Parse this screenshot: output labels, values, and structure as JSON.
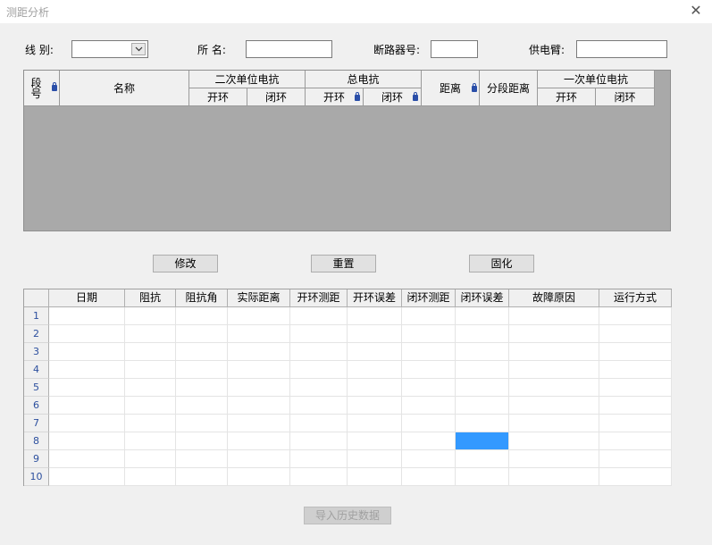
{
  "window": {
    "title": "测距分析",
    "close_icon": "close-icon"
  },
  "form": {
    "line_label": "线  别:",
    "line_value": "",
    "station_label": "所  名:",
    "station_value": "",
    "breaker_label": "断路器号:",
    "breaker_value": "",
    "feeder_label": "供电臂:",
    "feeder_value": ""
  },
  "section_table": {
    "headers": {
      "segment_no": "段号",
      "name": "名称",
      "secondary_unit_reactance": "二次单位电抗",
      "secondary_open": "开环",
      "secondary_closed": "闭环",
      "total_reactance": "总电抗",
      "total_open": "开环",
      "total_closed": "闭环",
      "distance": "距离",
      "segment_distance": "分段距离",
      "primary_unit_reactance": "一次单位电抗",
      "primary_open": "开环",
      "primary_closed": "闭环"
    }
  },
  "actions": {
    "modify": "修改",
    "reset": "重置",
    "solidify": "固化",
    "import_history": "导入历史数据"
  },
  "history_table": {
    "columns": [
      "日期",
      "阻抗",
      "阻抗角",
      "实际距离",
      "开环测距",
      "开环误差",
      "闭环测距",
      "闭环误差",
      "故障原因",
      "运行方式"
    ],
    "row_numbers": [
      "1",
      "2",
      "3",
      "4",
      "5",
      "6",
      "7",
      "8",
      "9",
      "10"
    ],
    "selected_cell": {
      "row": "8",
      "column": "闭环误差"
    },
    "selection_color": "#3399ff"
  }
}
